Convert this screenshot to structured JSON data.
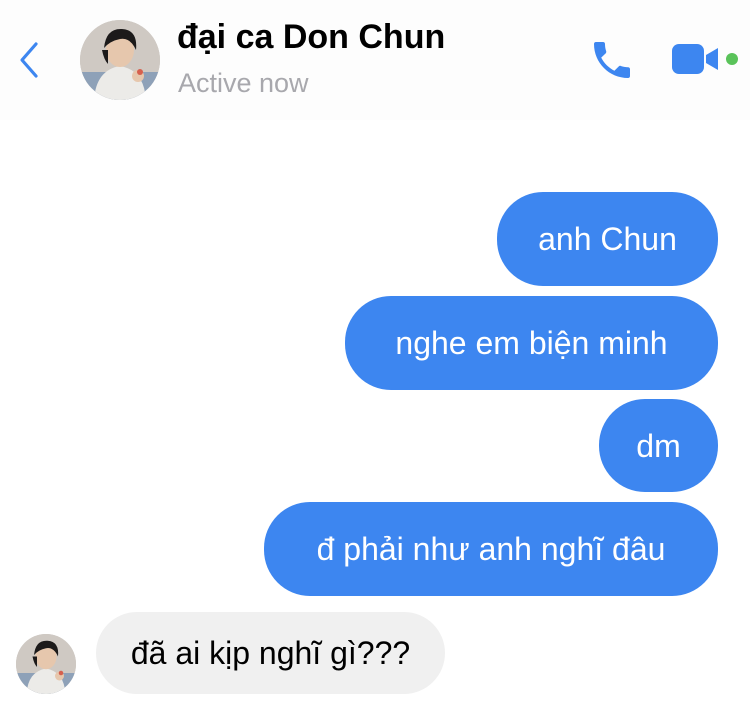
{
  "header": {
    "contact_name": "đại ca Don Chun",
    "status": "Active now",
    "back_icon": "chevron-left-icon",
    "call_icon": "phone-icon",
    "video_icon": "video-camera-icon",
    "accent_color": "#3d86f0",
    "online_indicator_color": "#5ac35a"
  },
  "messages": [
    {
      "direction": "outgoing",
      "text": "anh Chun"
    },
    {
      "direction": "outgoing",
      "text": "nghe em biện minh"
    },
    {
      "direction": "outgoing",
      "text": "dm"
    },
    {
      "direction": "outgoing",
      "text": "đ phải như anh nghĩ đâu"
    },
    {
      "direction": "incoming",
      "text": "đã ai kịp nghĩ gì???"
    }
  ],
  "colors": {
    "outgoing_bubble": "#3d86f0",
    "incoming_bubble": "#f0f0f0",
    "status_text": "#a8a8ad"
  }
}
